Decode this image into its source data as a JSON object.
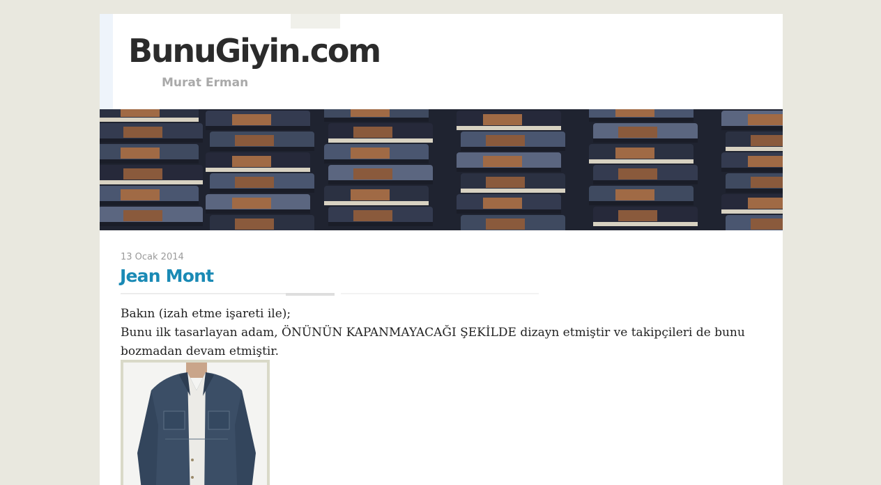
{
  "header": {
    "site_title": "BunuGiyin.com",
    "site_subtitle": "Murat Erman"
  },
  "banner": {
    "icon": "jeans-banner-image"
  },
  "post": {
    "date": "13 Ocak 2014",
    "title": "Jean Mont",
    "paragraphs": [
      "Bakın (izah etme işareti ile);",
      "Bunu ilk tasarlayan adam, ÖNÜNÜN KAPANMAYACAĞI ŞEKİLDE dizayn etmiştir ve takipçileri de bunu bozmadan devam etmiştir."
    ],
    "image_icon": "denim-jacket-photo"
  },
  "colors": {
    "background": "#e9e8df",
    "title_accent": "#1a8ab5",
    "site_title": "#2b2b2b",
    "subtitle": "#a9a9a9"
  }
}
